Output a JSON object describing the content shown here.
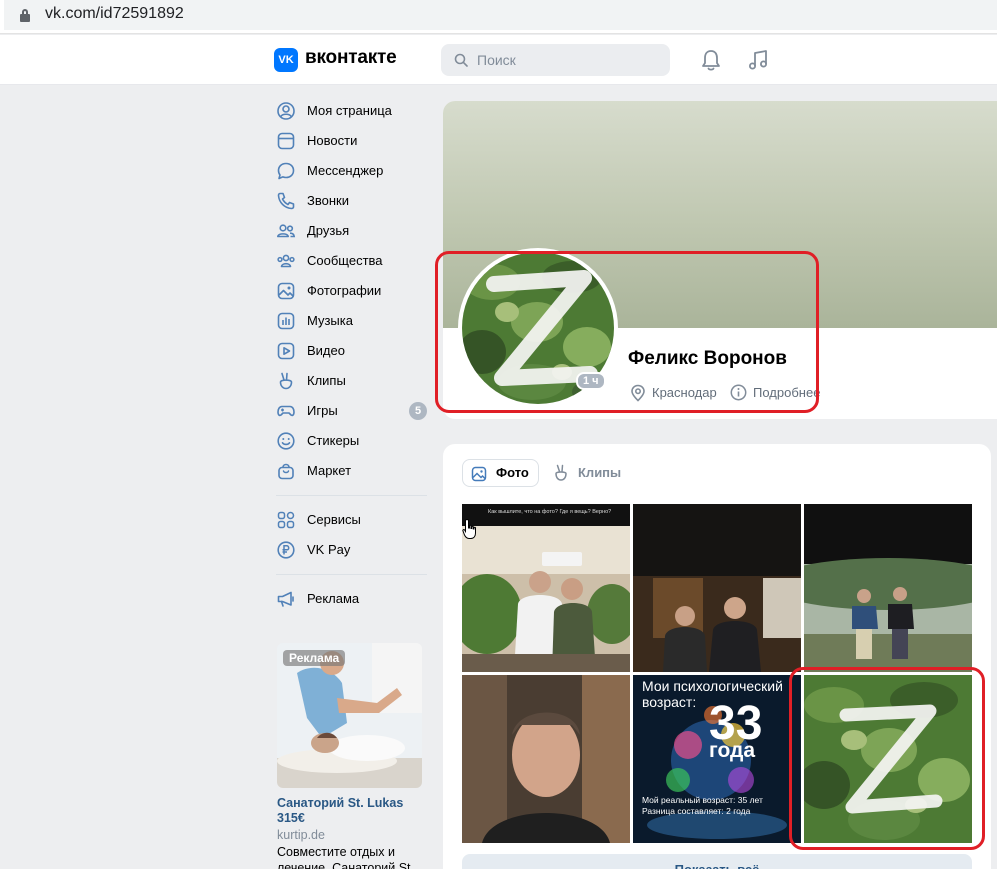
{
  "browser": {
    "url": "vk.com/id72591892"
  },
  "header": {
    "logo_mark": "VK",
    "brand": "вконтакте",
    "search_placeholder": "Поиск"
  },
  "menu": {
    "items": [
      {
        "label": "Моя страница",
        "icon": "user-circle-icon"
      },
      {
        "label": "Новости",
        "icon": "newsfeed-icon"
      },
      {
        "label": "Мессенджер",
        "icon": "message-icon"
      },
      {
        "label": "Звонки",
        "icon": "phone-icon"
      },
      {
        "label": "Друзья",
        "icon": "friends-icon"
      },
      {
        "label": "Сообщества",
        "icon": "communities-icon"
      },
      {
        "label": "Фотографии",
        "icon": "photo-icon"
      },
      {
        "label": "Музыка",
        "icon": "music-icon"
      },
      {
        "label": "Видео",
        "icon": "video-icon"
      },
      {
        "label": "Клипы",
        "icon": "clips-icon"
      },
      {
        "label": "Игры",
        "icon": "gamepad-icon",
        "badge": "5"
      },
      {
        "label": "Стикеры",
        "icon": "smile-icon"
      },
      {
        "label": "Маркет",
        "icon": "market-icon"
      }
    ],
    "secondary": [
      {
        "label": "Сервисы",
        "icon": "services-icon"
      },
      {
        "label": "VK Pay",
        "icon": "vkpay-icon"
      }
    ],
    "tertiary": [
      {
        "label": "Реклама",
        "icon": "megaphone-icon"
      }
    ]
  },
  "ad": {
    "badge": "Реклама",
    "title": "Санаторий St. Lukas 315€",
    "domain": "kurtip.de",
    "text": "Совместите отдых и лечение. Санаторий St"
  },
  "profile": {
    "name": "Феликс Воронов",
    "online": "1 ч",
    "city": "Краснодар",
    "details": "Подробнее"
  },
  "photos": {
    "tab_photo": "Фото",
    "tab_clips": "Клипы",
    "tile_text_top": "Как вышлите, что на фото? Где я вещь? Верно?",
    "psych_line1": "Мои психологический",
    "psych_line2": "возраст:",
    "psych_age": "33",
    "psych_unit": "года",
    "psych_real": "Мой реальный возраст: 35 лет",
    "psych_diff": "Разница составляет: 2 года",
    "show_all": "Показать всё"
  },
  "colors": {
    "accent": "#0077ff",
    "link": "#2a5885",
    "highlight": "#e01f26",
    "icon": "#5181b8"
  }
}
